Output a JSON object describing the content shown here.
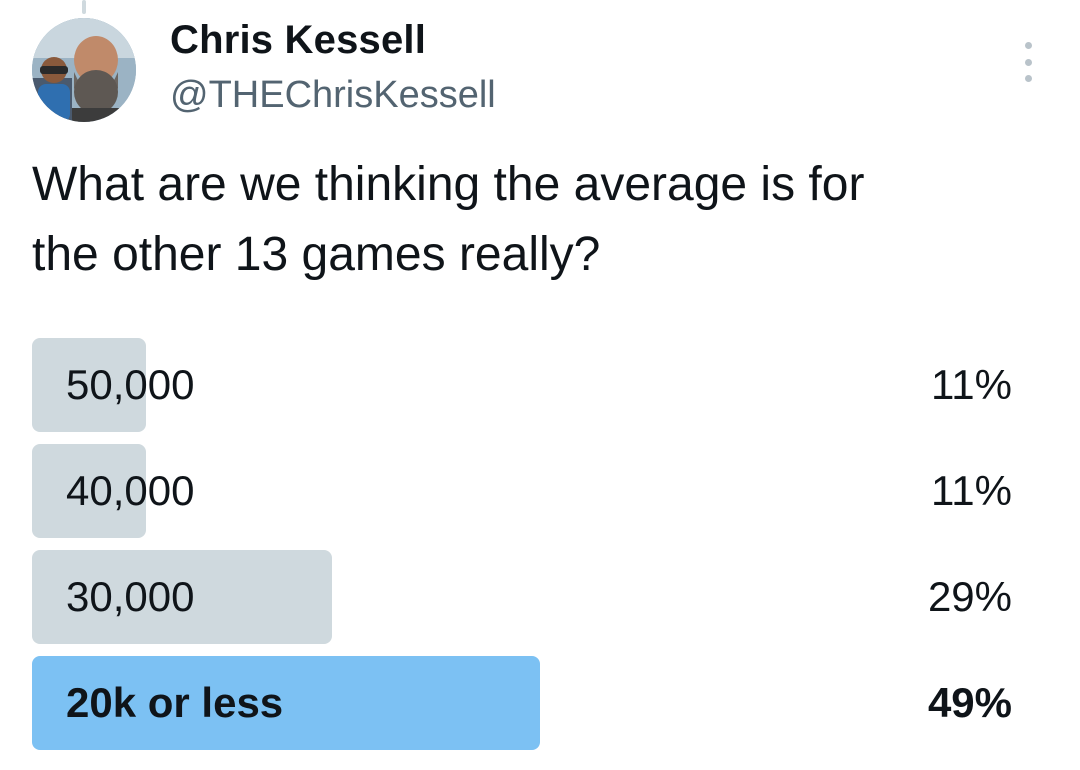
{
  "tweet": {
    "author": {
      "name": "Chris Kessell",
      "handle": "@THEChrisKessell",
      "avatar_icon": "profile-photo"
    },
    "more_icon": "vertical-ellipsis-icon",
    "text": "What are we thinking the average is for\nthe other 13 games really?"
  },
  "poll": {
    "options": [
      {
        "label": "50,000",
        "percent_text": "11%",
        "fraction": 0.11,
        "winner": false
      },
      {
        "label": "40,000",
        "percent_text": "11%",
        "fraction": 0.11,
        "winner": false
      },
      {
        "label": "30,000",
        "percent_text": "29%",
        "fraction": 0.29,
        "winner": false
      },
      {
        "label": "20k or less",
        "percent_text": "49%",
        "fraction": 0.49,
        "winner": true
      }
    ],
    "colors": {
      "bar": "#cfd9de",
      "winner_bar": "#7cc1f3"
    }
  }
}
